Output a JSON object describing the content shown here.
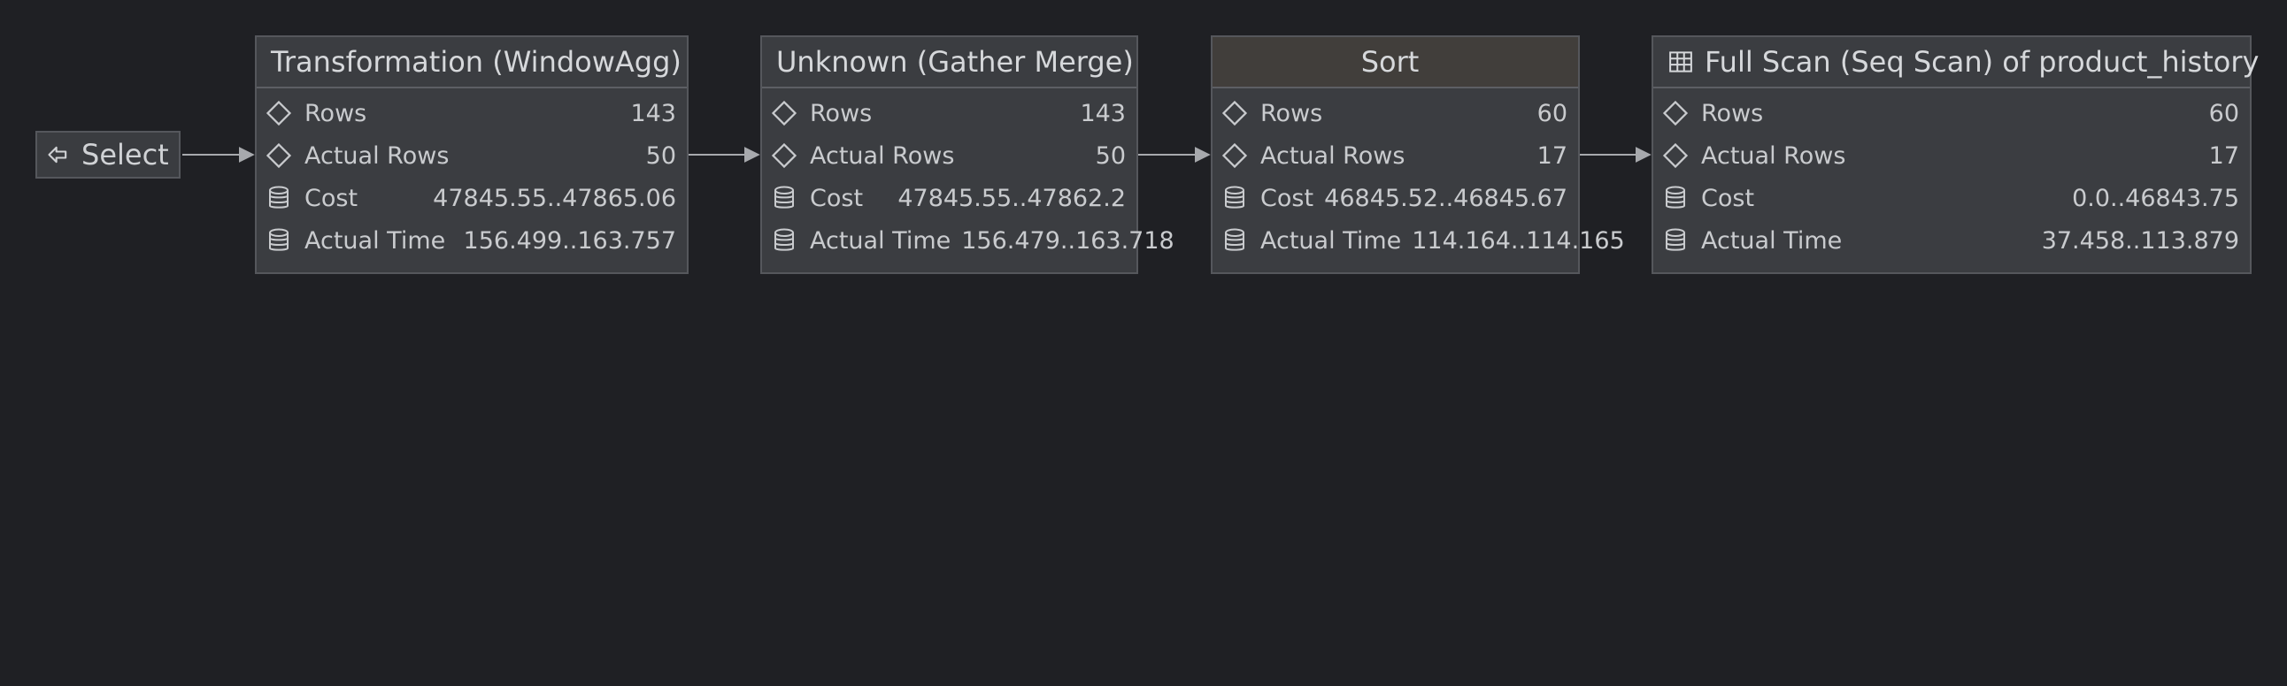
{
  "select": {
    "label": "Select",
    "icon": "arrow-left-exit-icon"
  },
  "nodes": [
    {
      "title": "Transformation (WindowAgg)",
      "metrics": [
        {
          "label": "Rows",
          "value": "143",
          "icon": "diamond-icon"
        },
        {
          "label": "Actual Rows",
          "value": "50",
          "icon": "diamond-icon"
        },
        {
          "label": "Cost",
          "value": "47845.55..47865.06",
          "icon": "database-icon"
        },
        {
          "label": "Actual Time",
          "value": "156.499..163.757",
          "icon": "database-icon"
        }
      ]
    },
    {
      "title": "Unknown (Gather Merge)",
      "metrics": [
        {
          "label": "Rows",
          "value": "143",
          "icon": "diamond-icon"
        },
        {
          "label": "Actual Rows",
          "value": "50",
          "icon": "diamond-icon"
        },
        {
          "label": "Cost",
          "value": "47845.55..47862.2",
          "icon": "database-icon"
        },
        {
          "label": "Actual Time",
          "value": "156.479..163.718",
          "icon": "database-icon"
        }
      ]
    },
    {
      "title": "Sort",
      "metrics": [
        {
          "label": "Rows",
          "value": "60",
          "icon": "diamond-icon"
        },
        {
          "label": "Actual Rows",
          "value": "17",
          "icon": "diamond-icon"
        },
        {
          "label": "Cost",
          "value": "46845.52..46845.67",
          "icon": "database-icon"
        },
        {
          "label": "Actual Time",
          "value": "114.164..114.165",
          "icon": "database-icon"
        }
      ]
    },
    {
      "title": "Full Scan (Seq Scan) of product_history",
      "icon": "table-icon",
      "metrics": [
        {
          "label": "Rows",
          "value": "60",
          "icon": "diamond-icon"
        },
        {
          "label": "Actual Rows",
          "value": "17",
          "icon": "diamond-icon"
        },
        {
          "label": "Cost",
          "value": "0.0..46843.75",
          "icon": "database-icon"
        },
        {
          "label": "Actual Time",
          "value": "37.458..113.879",
          "icon": "database-icon"
        }
      ]
    }
  ],
  "colors": {
    "background": "#1f2024",
    "node_fill": "#3b3d41",
    "node_border": "#55575c",
    "edge": "#a7a9ad",
    "text": "#c9cbce"
  }
}
